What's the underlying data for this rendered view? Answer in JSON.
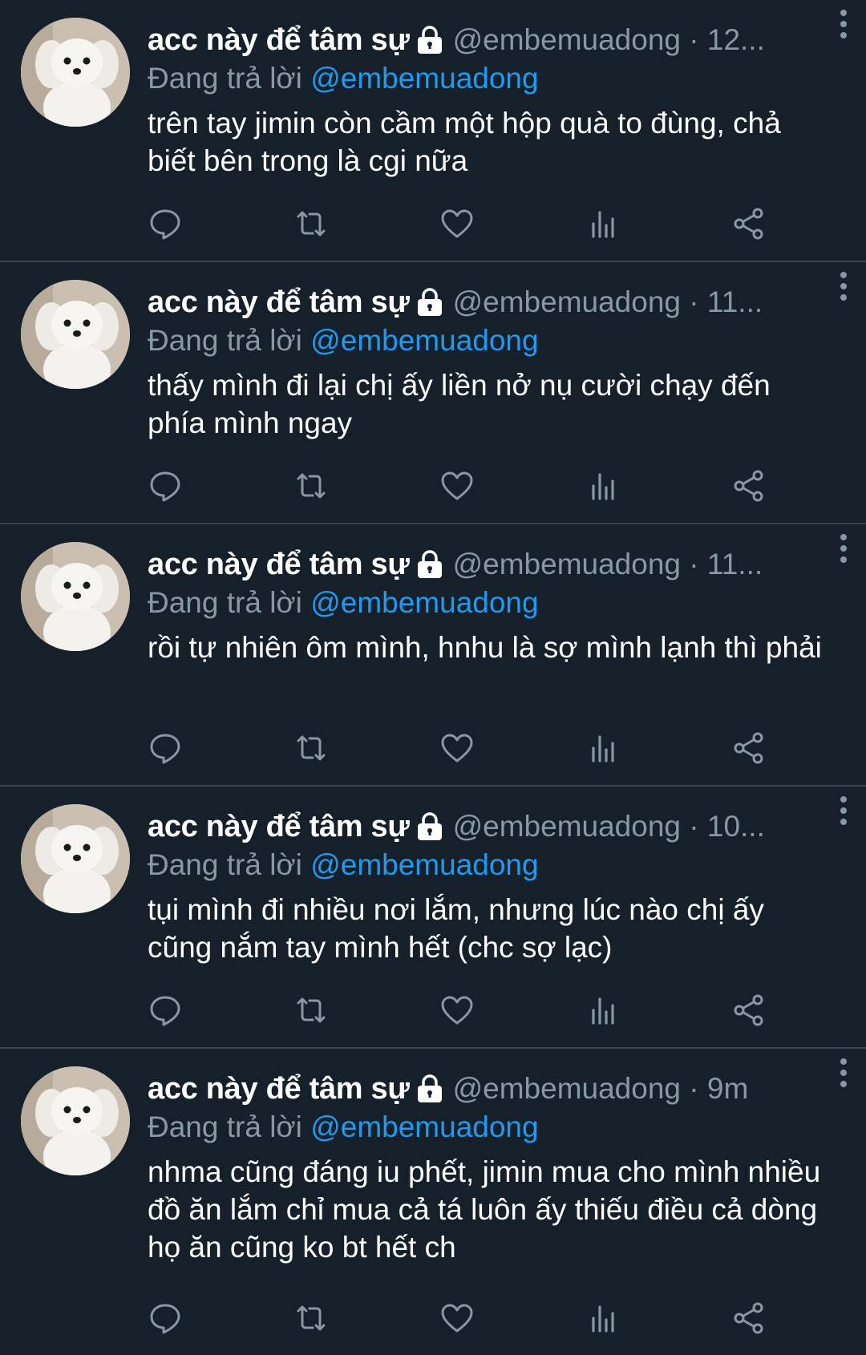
{
  "colors": {
    "background": "#15202b",
    "divider": "#38444d",
    "secondary_text": "#8899a6",
    "mention": "#1d9bf0",
    "primary_text": "#ffffff"
  },
  "icons": {
    "lock": "lock-icon",
    "more": "more-vertical-icon",
    "reply": "reply-icon",
    "retweet": "retweet-icon",
    "like": "heart-icon",
    "analytics": "analytics-icon",
    "share": "share-icon"
  },
  "tweets": [
    {
      "display_name": "acc này để tâm sự",
      "handle_time": "@embemuadong · 12...",
      "reply_prefix": "Đang trả lời ",
      "reply_to": "@embemuadong",
      "text": "trên tay jimin còn cầm một hộp quà to đùng, chả biết bên trong là cgi nữa"
    },
    {
      "display_name": "acc này để tâm sự",
      "handle_time": "@embemuadong · 11...",
      "reply_prefix": "Đang trả lời ",
      "reply_to": "@embemuadong",
      "text": "thấy mình đi lại chị ấy liền nở nụ cười chạy đến phía mình ngay"
    },
    {
      "display_name": "acc này để tâm sự",
      "handle_time": "@embemuadong · 11...",
      "reply_prefix": "Đang trả lời ",
      "reply_to": "@embemuadong",
      "text": "rồi tự nhiên ôm mình, hnhu là sợ mình lạnh thì phải"
    },
    {
      "display_name": "acc này để tâm sự",
      "handle_time": "@embemuadong · 10...",
      "reply_prefix": "Đang trả lời ",
      "reply_to": "@embemuadong",
      "text": "tụi mình đi nhiều nơi lắm, nhưng lúc nào chị ấy cũng nắm tay mình hết (chc sợ lạc)"
    },
    {
      "display_name": "acc này để tâm sự",
      "handle_time": "@embemuadong · 9m",
      "reply_prefix": "Đang trả lời ",
      "reply_to": "@embemuadong",
      "text": "nhma cũng đáng iu phết, jimin mua cho mình nhiều đồ ăn lắm chỉ mua cả tá luôn ấy thiếu điều cả dòng họ ăn cũng ko bt hết ch"
    }
  ]
}
